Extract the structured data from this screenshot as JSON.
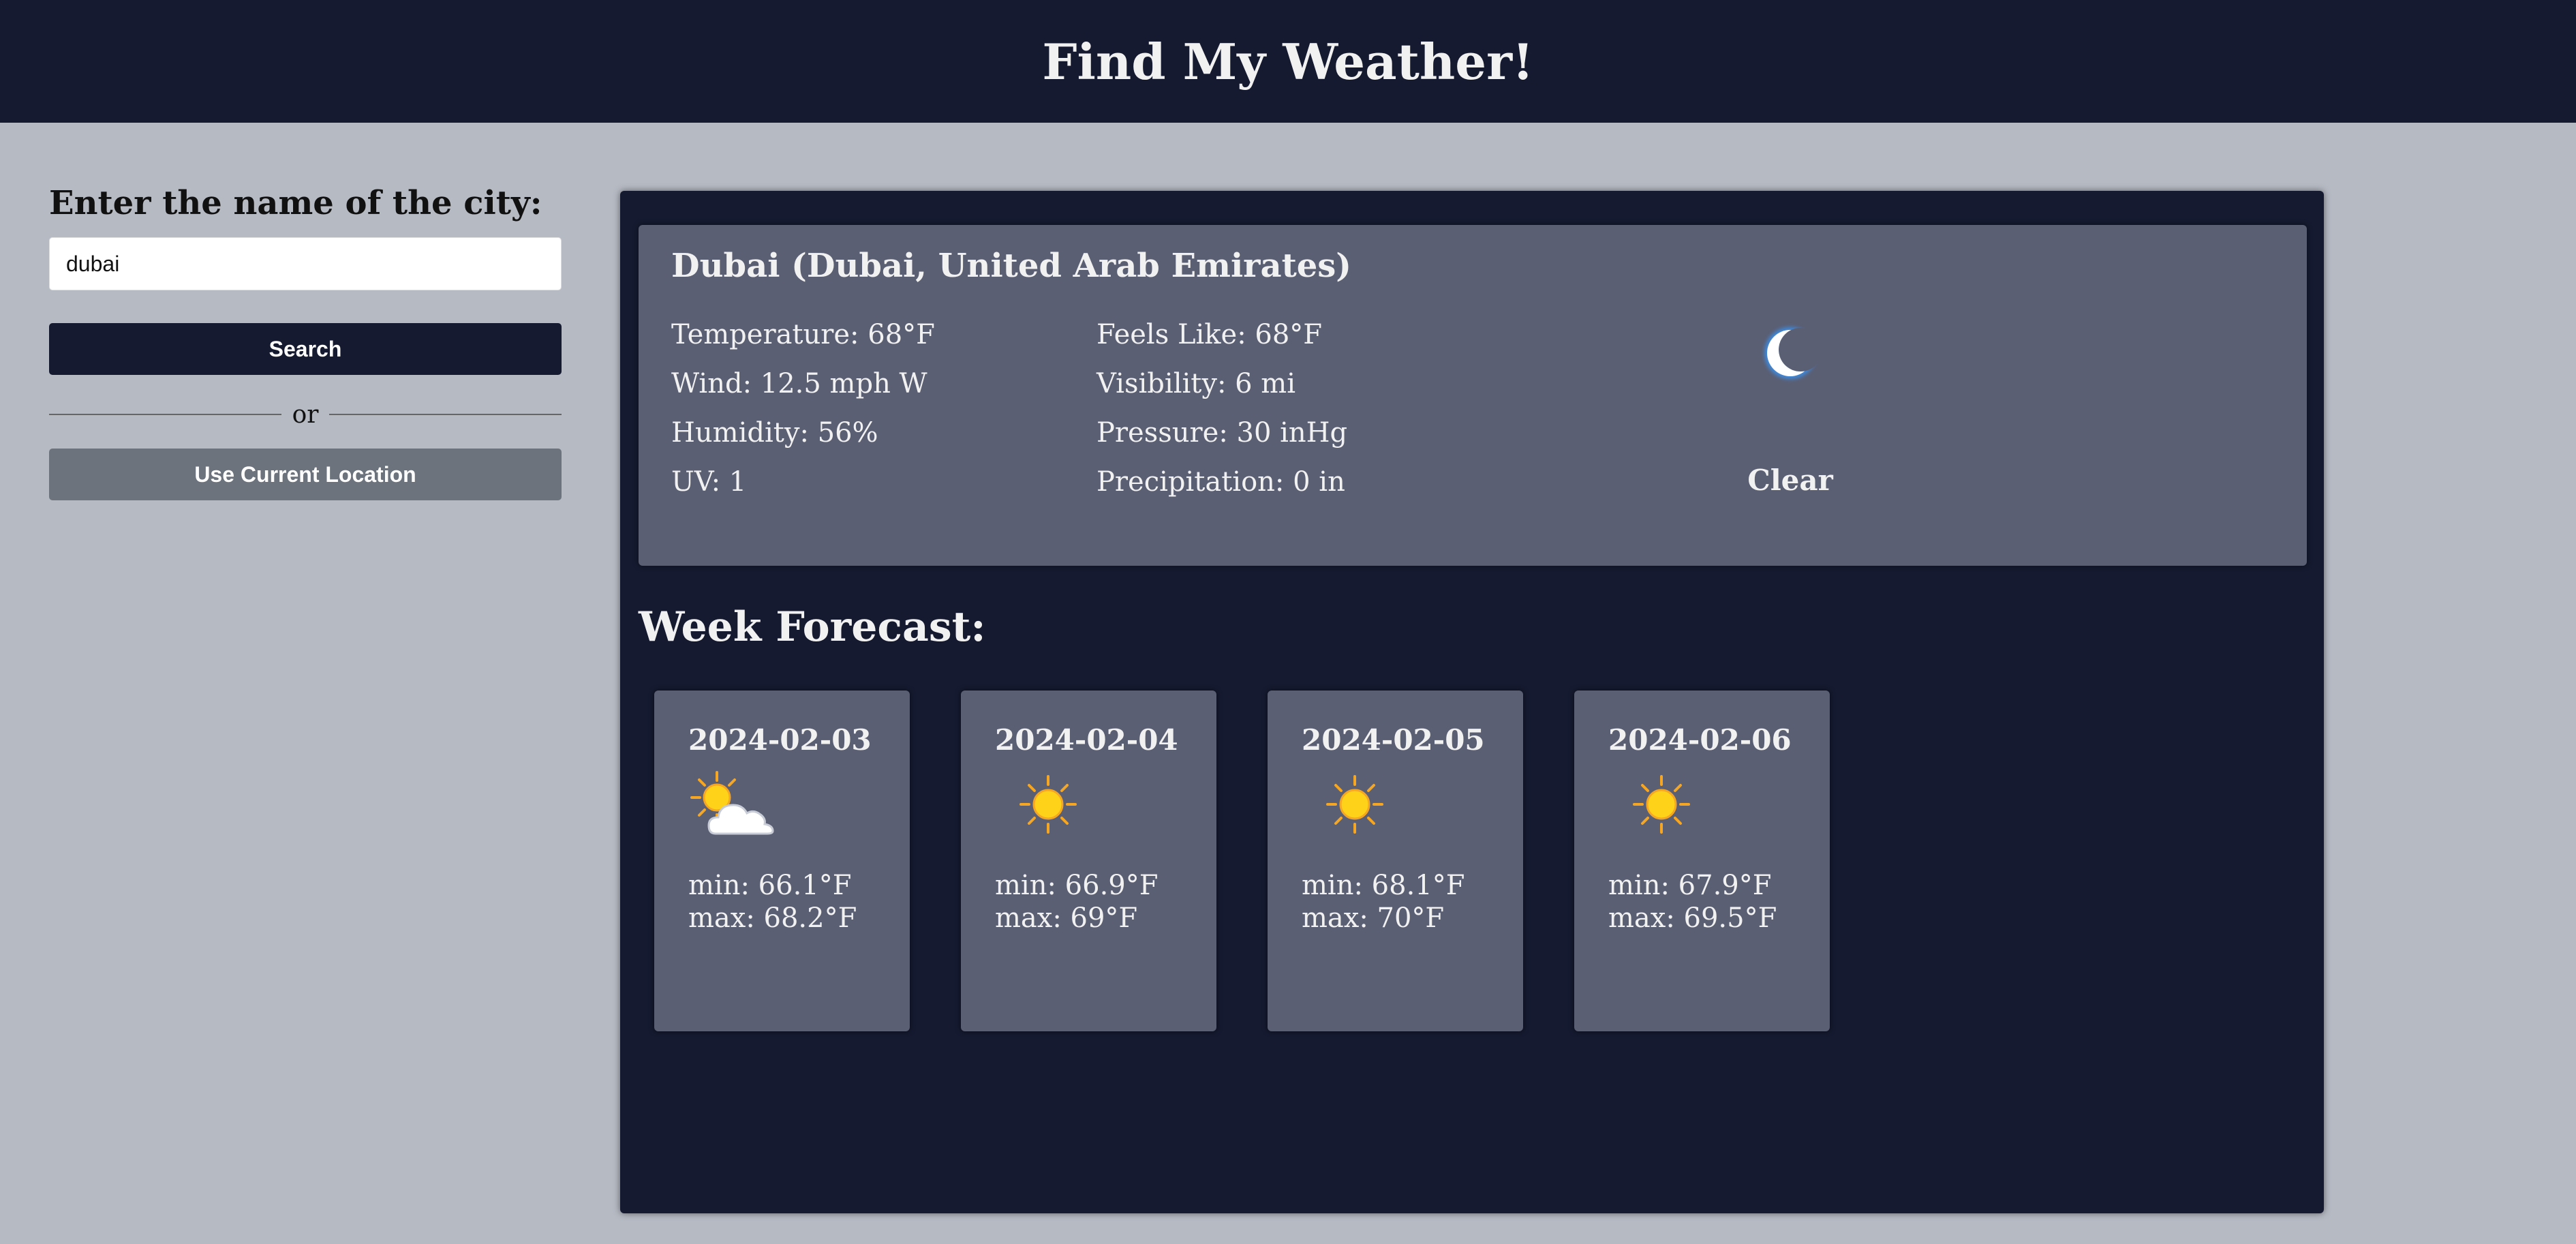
{
  "header": {
    "title": "Find My Weather!"
  },
  "search": {
    "label": "Enter the name of the city:",
    "value": "dubai",
    "search_button": "Search",
    "or_text": "or",
    "location_button": "Use Current Location"
  },
  "current": {
    "location": "Dubai (Dubai, United Arab Emirates)",
    "stats_left": [
      "Temperature: 68°F",
      "Wind: 12.5 mph W",
      "Humidity: 56%",
      "UV: 1"
    ],
    "stats_right": [
      "Feels Like: 68°F",
      "Visibility: 6 mi",
      "Pressure: 30 inHg",
      "Precipitation: 0 in"
    ],
    "condition": "Clear",
    "icon": "crescent-moon-icon"
  },
  "forecast": {
    "title": "Week Forecast:",
    "days": [
      {
        "date": "2024-02-03",
        "icon": "partly-cloudy-icon",
        "min": "min: 66.1°F",
        "max": "max: 68.2°F"
      },
      {
        "date": "2024-02-04",
        "icon": "sun-icon",
        "min": "min: 66.9°F",
        "max": "max: 69°F"
      },
      {
        "date": "2024-02-05",
        "icon": "sun-icon",
        "min": "min: 68.1°F",
        "max": "max: 70°F"
      },
      {
        "date": "2024-02-06",
        "icon": "sun-icon",
        "min": "min: 67.9°F",
        "max": "max: 69.5°F"
      }
    ]
  },
  "colors": {
    "header_bg": "#151a30",
    "page_bg": "#b6bac3",
    "card_bg": "#5b5f73",
    "secondary_button": "#6c737d"
  }
}
